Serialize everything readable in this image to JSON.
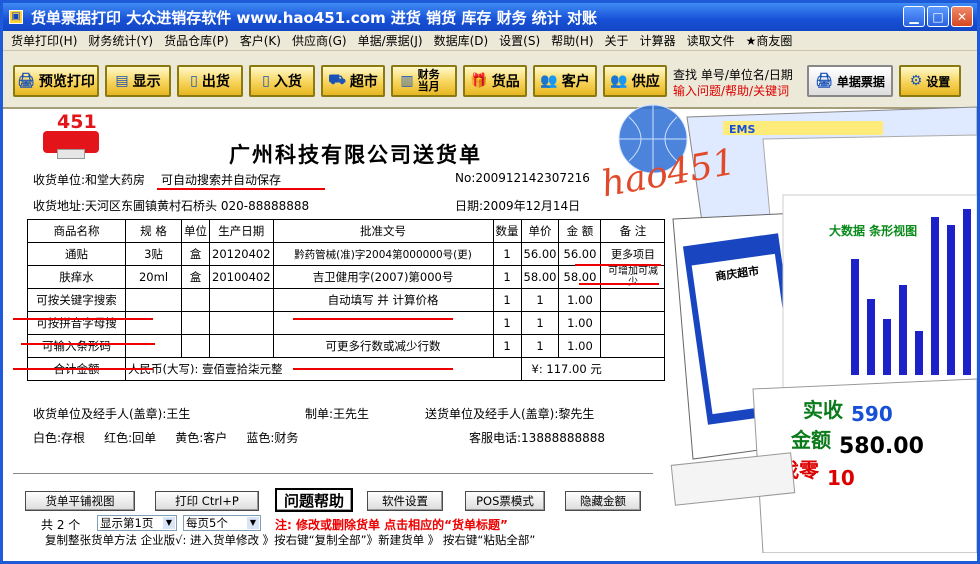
{
  "window": {
    "title": "货单票据打印  大众进销存软件  www.hao451.com  进货  销货  库存  财务  统计  对账"
  },
  "menu": [
    "货单打印(H)",
    "财务统计(Y)",
    "货品仓库(P)",
    "客户(K)",
    "供应商(G)",
    "单据/票据(J)",
    "数据库(D)",
    "设置(S)",
    "帮助(H)",
    "关于",
    "计算器",
    "读取文件",
    "★商友圈"
  ],
  "toolbar": {
    "preview_print": "预览打印",
    "display": "显示",
    "outbound": "出货",
    "inbound": "入货",
    "supermarket": "超市",
    "finance": "财务当月",
    "goods": "货品",
    "customer": "客户",
    "supplier": "供应",
    "search_hint": "查找 单号/单位名/日期",
    "help_hint": "输入问题/帮助/关键词",
    "bill_receipt": "单据票据",
    "settings": "设置"
  },
  "logo": {
    "number": "451"
  },
  "doc": {
    "title": "广州科技有限公司送货单",
    "receiver_label": "收货单位:和堂大药房",
    "autosave_note": "可自动搜索并自动保存",
    "no": "No:200912142307216",
    "address": "收货地址:天河区东圃镇黄村石桥头   020-88888888",
    "date": "日期:2009年12月14日"
  },
  "table": {
    "headers": [
      "商品名称",
      "规 格",
      "单位",
      "生产日期",
      "批准文号",
      "数量",
      "单价",
      "金 额",
      "备 注"
    ],
    "rows": [
      [
        "通贴",
        "3贴",
        "盒",
        "20120402",
        "黔药管械(准)字2004第000000号(更)",
        "1",
        "56.00",
        "56.00",
        "更多项目"
      ],
      [
        "肤痒水",
        "20ml",
        "盒",
        "20100402",
        "吉卫健用字(2007)第000号",
        "1",
        "58.00",
        "58.00",
        "可增加可减少"
      ],
      [
        "可按关键字搜索",
        "",
        "",
        "",
        "自动填写 并 计算价格",
        "1",
        "1",
        "1.00",
        ""
      ],
      [
        "可按拼音字母搜",
        "",
        "",
        "",
        "",
        "1",
        "1",
        "1.00",
        ""
      ],
      [
        "可输入条形码",
        "",
        "",
        "",
        "可更多行数或减少行数",
        "1",
        "1",
        "1.00",
        ""
      ]
    ],
    "total_label": "合计金额",
    "total_text": "人民币(大写): 壹佰壹拾柒元整",
    "total_value": "¥: 117.00 元"
  },
  "footer": {
    "receiver_sign": "收货单位及经手人(盖章):王生",
    "maker": "制单:王先生",
    "sender_sign": "送货单位及经手人(盖章):黎先生",
    "colors": "白色:存根     红色:回单     黄色:客户     蓝色:财务",
    "hotline": "客服电话:13888888888"
  },
  "buttons": {
    "flat_view": "货单平铺视图",
    "print": "打印 Ctrl+P",
    "help": "问题帮助",
    "software_settings": "软件设置",
    "pos_mode": "POS票模式",
    "hide_amount": "隐藏金额"
  },
  "pager": {
    "total": "共 2 个",
    "display_select": "显示第1页",
    "per_page_select": "每页5个",
    "note": "注: 修改或删除货单  点击相应的“货单标题”",
    "copy_tip": "复制整张货单方法  企业版√: 进入货单修改 》按右键“复制全部”》新建货单 》 按右键“粘贴全部”"
  },
  "collage": {
    "brand": "hao451",
    "chart_title": "大数据 条形视图",
    "paid_label": "实收",
    "paid_value": "590",
    "amount_label": "金额",
    "amount_value": "580.00",
    "change_label": "找零",
    "change_value": "10",
    "ems": "EMS",
    "supermarket_title": "商庆超市"
  },
  "colors": {
    "titlebar": "#1750d6",
    "menu_bg": "#ece9d8",
    "toolbar_btn": "#f7d35a",
    "accent_red": "#e00000"
  }
}
